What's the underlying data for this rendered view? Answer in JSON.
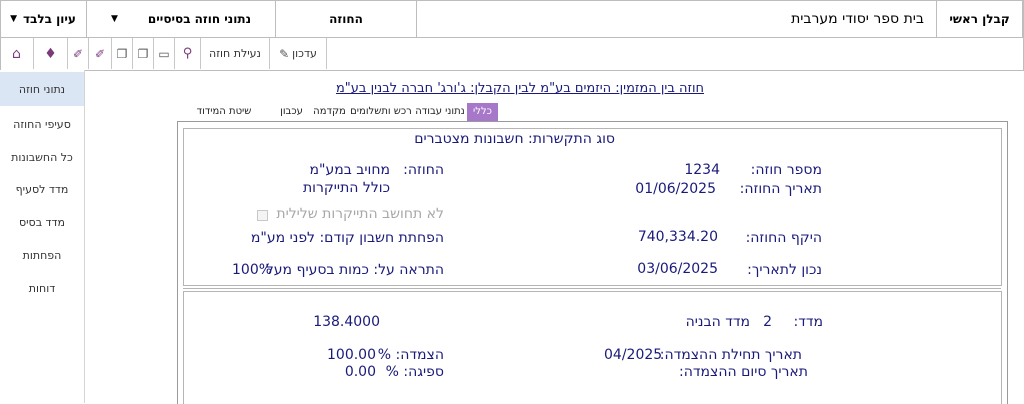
{
  "header": {
    "main_contractor": "קבלן ראשי",
    "project_name": "בית ספר יסודי מערבית",
    "contract_label": "החוזה",
    "basic_data_select": "נתוני חוזה בסיסיים",
    "view_only_select": "עיון בלבד"
  },
  "toolbar": {
    "update_label": "עדכון",
    "lock_contract_label": "נעילת חוזה",
    "icons": [
      "home-icon",
      "person-icon",
      "pin-icon",
      "pin-icon",
      "window-icon",
      "window-icon",
      "document-icon",
      "search-icon",
      "edit-icon"
    ]
  },
  "sidebar": {
    "items": [
      {
        "label": "נתוני חוזה",
        "active": true
      },
      {
        "label": "סעיפי החוזה",
        "active": false
      },
      {
        "label": "כל החשבונות",
        "active": false
      },
      {
        "label": "מדד לסעיף",
        "active": false
      },
      {
        "label": "מדד בסיס",
        "active": false
      },
      {
        "label": "הפחתות",
        "active": false
      },
      {
        "label": "דוחות",
        "active": false
      }
    ]
  },
  "title": "חוזה בין המזמין: היזמים בע\"מ  לבין הקבלן: ג'ורג' חברה לבנין בע\"מ",
  "tabs": [
    {
      "label": "כללי",
      "active": true
    },
    {
      "label": "נתוני עבודה",
      "active": false
    },
    {
      "label": "רכש ותשלומים",
      "active": false
    },
    {
      "label": "מקדמה",
      "active": false
    },
    {
      "label": "עכבון",
      "active": false
    },
    {
      "label": "שיטת המידוד",
      "active": false
    }
  ],
  "form": {
    "contract_type": "סוג התקשרות: חשבונות מצטברים",
    "contract_number_label": "מספר חוזה:",
    "contract_number": "1234",
    "contract_date_label": "תאריך החוזה:",
    "contract_date": "01/06/2025",
    "contract_scope_label": "היקף החוזה:",
    "contract_scope": "740,334.20",
    "correct_to_label": "נכון לתאריך:",
    "correct_to": "03/06/2025",
    "contract_label": "החוזה:",
    "contract_value": "מחויב במע\"מ",
    "contract_value_2": "כולל התייקרות",
    "no_negative_label": "לא תחושב התייקרות שלילית",
    "prev_bill_label": "הפחתת חשבון קודם: לפני מע\"מ",
    "alert_label": "התראה על: כמות בסעיף מעל",
    "alert_value": "100%",
    "index_label": "מדד:",
    "index_number": "2",
    "index_name": "מדד הבניה",
    "index_value": "138.4000",
    "linkage_start_label": "תאריך תחילת ההצמדה:",
    "linkage_start": "04/2025",
    "linkage_end_label": "תאריך  סיום ההצמדה:",
    "linkage_pct_label": "הצמדה: %",
    "linkage_pct": "100.00",
    "absorption_label": "ספיגה: %",
    "absorption_pct": "0.00"
  },
  "colors": {
    "accent": "#a777c9",
    "sidebar_active": "#dbe6f4",
    "text_blue": "#1a1a7a"
  }
}
